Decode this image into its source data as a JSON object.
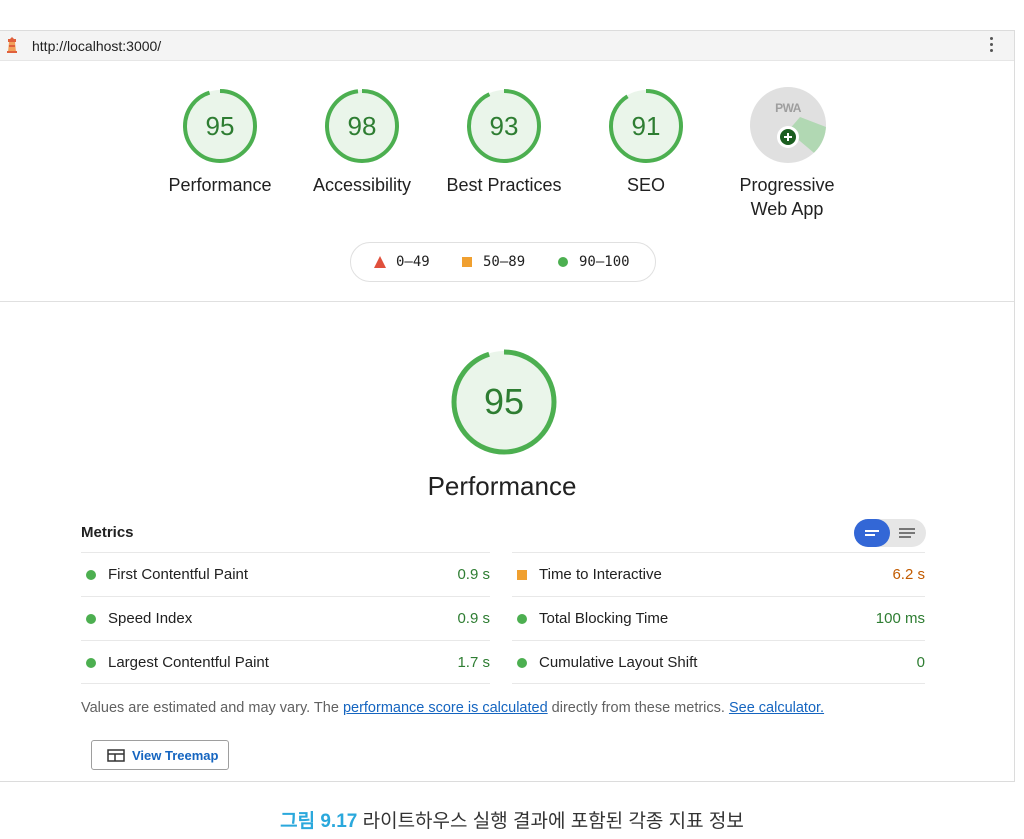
{
  "url_bar": {
    "url": "http://localhost:3000/",
    "lighthouse_icon": "lighthouse-icon",
    "menu_icon": "kebab-menu-icon"
  },
  "categories": [
    {
      "label": "Performance",
      "score": "95"
    },
    {
      "label": "Accessibility",
      "score": "98"
    },
    {
      "label": "Best Practices",
      "score": "93"
    },
    {
      "label": "SEO",
      "score": "91"
    }
  ],
  "pwa": {
    "label_line1": "Progressive",
    "label_line2": "Web App",
    "badge_text": "PWA",
    "icon": "pwa-plus-icon"
  },
  "legend": [
    {
      "range": "0–49",
      "shape": "triangle",
      "color": "#e0503c"
    },
    {
      "range": "50–89",
      "shape": "square",
      "color": "#f0a030"
    },
    {
      "range": "90–100",
      "shape": "circle",
      "color": "#4caf50"
    }
  ],
  "performance": {
    "score": "95",
    "title": "Performance"
  },
  "metrics": {
    "title": "Metrics",
    "left": [
      {
        "name": "First Contentful Paint",
        "value": "0.9 s",
        "status": "pass"
      },
      {
        "name": "Speed Index",
        "value": "0.9 s",
        "status": "pass"
      },
      {
        "name": "Largest Contentful Paint",
        "value": "1.7 s",
        "status": "pass"
      }
    ],
    "right": [
      {
        "name": "Time to Interactive",
        "value": "6.2 s",
        "status": "average"
      },
      {
        "name": "Total Blocking Time",
        "value": "100 ms",
        "status": "pass"
      },
      {
        "name": "Cumulative Layout Shift",
        "value": "0",
        "status": "pass"
      }
    ]
  },
  "note": {
    "prefix": "Values are estimated and may vary. The ",
    "link1": "performance score is calculated",
    "middle": " directly from these metrics. ",
    "link2": "See calculator."
  },
  "treemap_button": {
    "label": "View Treemap",
    "icon": "treemap-icon"
  },
  "caption": {
    "figure": "그림 9.17",
    "text": " 라이트하우스 실행 결과에 포함된 각종 지표 정보"
  },
  "colors": {
    "pass": "#4caf50",
    "average": "#f0a030",
    "fail": "#e0503c",
    "accent": "#3367d6"
  }
}
